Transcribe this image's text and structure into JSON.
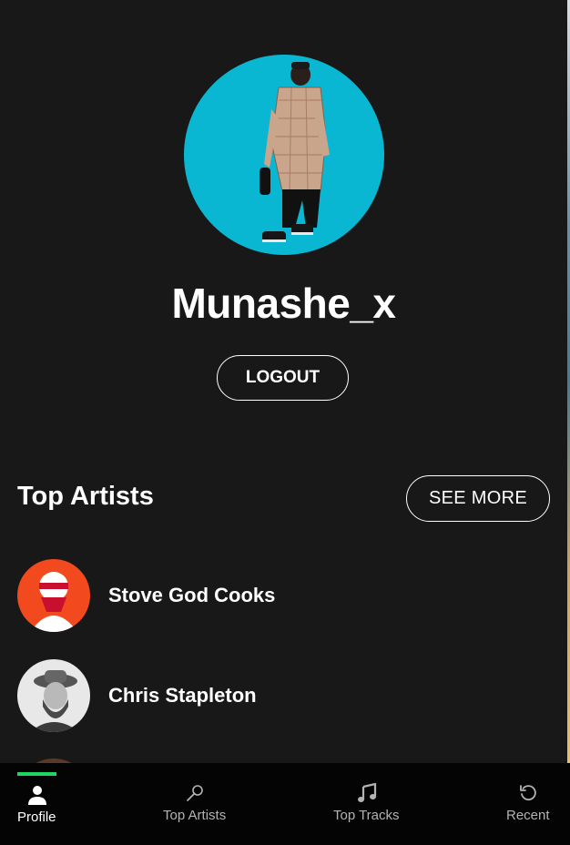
{
  "profile": {
    "username": "Munashe_x",
    "logout_label": "LOGOUT"
  },
  "top_artists": {
    "title": "Top Artists",
    "see_more_label": "SEE MORE",
    "items": [
      {
        "name": "Stove God Cooks"
      },
      {
        "name": "Chris Stapleton"
      }
    ]
  },
  "nav": {
    "items": [
      {
        "label": "Profile",
        "icon": "user-icon",
        "active": true
      },
      {
        "label": "Top Artists",
        "icon": "microphone-icon",
        "active": false
      },
      {
        "label": "Top Tracks",
        "icon": "music-note-icon",
        "active": false
      },
      {
        "label": "Recent",
        "icon": "history-icon",
        "active": false
      }
    ]
  },
  "colors": {
    "background": "#181818",
    "navbar": "#040404",
    "accent": "#1ed760",
    "avatar_bg": "#09b7d3"
  }
}
